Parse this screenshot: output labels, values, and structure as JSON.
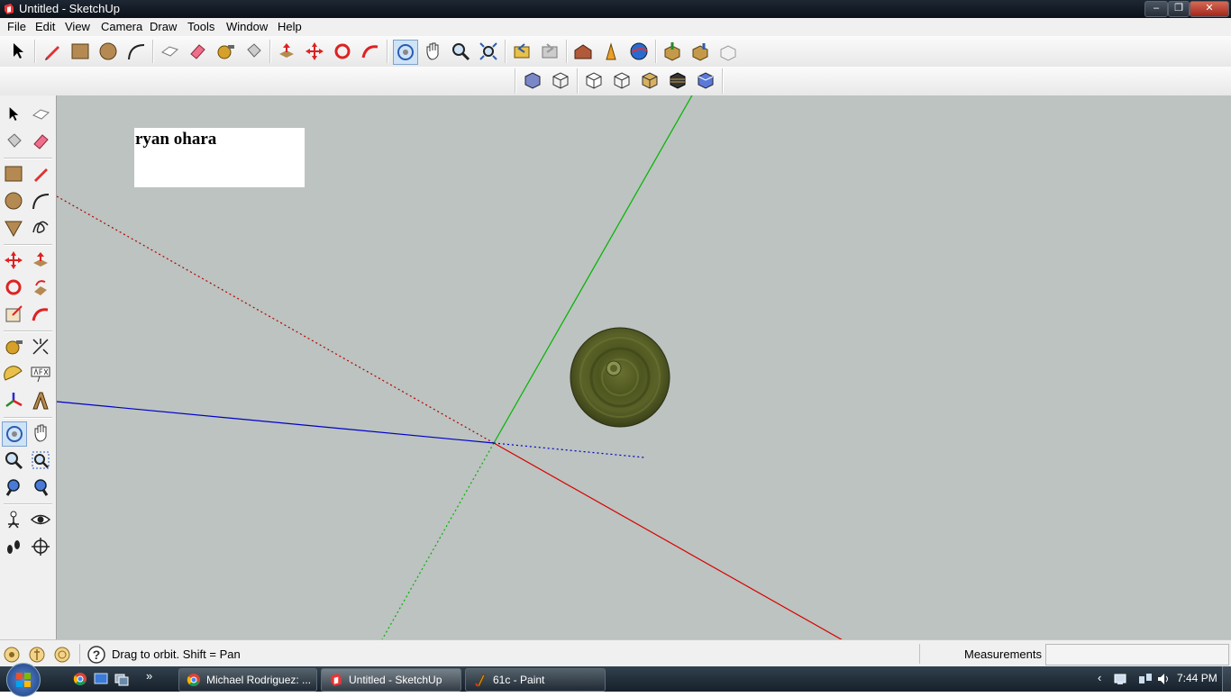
{
  "window": {
    "title": "Untitled - SketchUp",
    "minimize": "–",
    "maximize": "❐",
    "close": "✕"
  },
  "menu": [
    "File",
    "Edit",
    "View",
    "Camera",
    "Draw",
    "Tools",
    "Window",
    "Help"
  ],
  "viewport": {
    "name_label": "ryan ohara",
    "background": "#bcc3c0"
  },
  "status": {
    "hint": "Drag to orbit.  Shift = Pan",
    "measurements_label": "Measurements",
    "measurements_value": ""
  },
  "taskbar": {
    "tasks": [
      "Michael Rodriguez: ...",
      "Untitled - SketchUp",
      "61c - Paint"
    ],
    "clock": "7:44 PM"
  },
  "colors": {
    "axis_red": "#d80000",
    "axis_green": "#00b400",
    "axis_blue": "#0000c8"
  }
}
